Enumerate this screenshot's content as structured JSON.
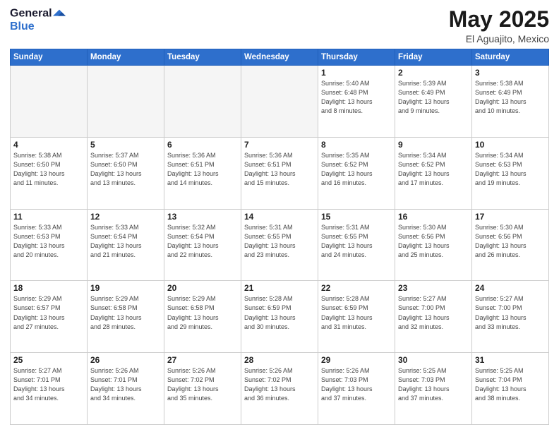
{
  "header": {
    "logo_general": "General",
    "logo_blue": "Blue",
    "month_title": "May 2025",
    "location": "El Aguajito, Mexico"
  },
  "days_of_week": [
    "Sunday",
    "Monday",
    "Tuesday",
    "Wednesday",
    "Thursday",
    "Friday",
    "Saturday"
  ],
  "weeks": [
    [
      {
        "day": "",
        "info": ""
      },
      {
        "day": "",
        "info": ""
      },
      {
        "day": "",
        "info": ""
      },
      {
        "day": "",
        "info": ""
      },
      {
        "day": "1",
        "info": "Sunrise: 5:40 AM\nSunset: 6:48 PM\nDaylight: 13 hours\nand 8 minutes."
      },
      {
        "day": "2",
        "info": "Sunrise: 5:39 AM\nSunset: 6:49 PM\nDaylight: 13 hours\nand 9 minutes."
      },
      {
        "day": "3",
        "info": "Sunrise: 5:38 AM\nSunset: 6:49 PM\nDaylight: 13 hours\nand 10 minutes."
      }
    ],
    [
      {
        "day": "4",
        "info": "Sunrise: 5:38 AM\nSunset: 6:50 PM\nDaylight: 13 hours\nand 11 minutes."
      },
      {
        "day": "5",
        "info": "Sunrise: 5:37 AM\nSunset: 6:50 PM\nDaylight: 13 hours\nand 13 minutes."
      },
      {
        "day": "6",
        "info": "Sunrise: 5:36 AM\nSunset: 6:51 PM\nDaylight: 13 hours\nand 14 minutes."
      },
      {
        "day": "7",
        "info": "Sunrise: 5:36 AM\nSunset: 6:51 PM\nDaylight: 13 hours\nand 15 minutes."
      },
      {
        "day": "8",
        "info": "Sunrise: 5:35 AM\nSunset: 6:52 PM\nDaylight: 13 hours\nand 16 minutes."
      },
      {
        "day": "9",
        "info": "Sunrise: 5:34 AM\nSunset: 6:52 PM\nDaylight: 13 hours\nand 17 minutes."
      },
      {
        "day": "10",
        "info": "Sunrise: 5:34 AM\nSunset: 6:53 PM\nDaylight: 13 hours\nand 19 minutes."
      }
    ],
    [
      {
        "day": "11",
        "info": "Sunrise: 5:33 AM\nSunset: 6:53 PM\nDaylight: 13 hours\nand 20 minutes."
      },
      {
        "day": "12",
        "info": "Sunrise: 5:33 AM\nSunset: 6:54 PM\nDaylight: 13 hours\nand 21 minutes."
      },
      {
        "day": "13",
        "info": "Sunrise: 5:32 AM\nSunset: 6:54 PM\nDaylight: 13 hours\nand 22 minutes."
      },
      {
        "day": "14",
        "info": "Sunrise: 5:31 AM\nSunset: 6:55 PM\nDaylight: 13 hours\nand 23 minutes."
      },
      {
        "day": "15",
        "info": "Sunrise: 5:31 AM\nSunset: 6:55 PM\nDaylight: 13 hours\nand 24 minutes."
      },
      {
        "day": "16",
        "info": "Sunrise: 5:30 AM\nSunset: 6:56 PM\nDaylight: 13 hours\nand 25 minutes."
      },
      {
        "day": "17",
        "info": "Sunrise: 5:30 AM\nSunset: 6:56 PM\nDaylight: 13 hours\nand 26 minutes."
      }
    ],
    [
      {
        "day": "18",
        "info": "Sunrise: 5:29 AM\nSunset: 6:57 PM\nDaylight: 13 hours\nand 27 minutes."
      },
      {
        "day": "19",
        "info": "Sunrise: 5:29 AM\nSunset: 6:58 PM\nDaylight: 13 hours\nand 28 minutes."
      },
      {
        "day": "20",
        "info": "Sunrise: 5:29 AM\nSunset: 6:58 PM\nDaylight: 13 hours\nand 29 minutes."
      },
      {
        "day": "21",
        "info": "Sunrise: 5:28 AM\nSunset: 6:59 PM\nDaylight: 13 hours\nand 30 minutes."
      },
      {
        "day": "22",
        "info": "Sunrise: 5:28 AM\nSunset: 6:59 PM\nDaylight: 13 hours\nand 31 minutes."
      },
      {
        "day": "23",
        "info": "Sunrise: 5:27 AM\nSunset: 7:00 PM\nDaylight: 13 hours\nand 32 minutes."
      },
      {
        "day": "24",
        "info": "Sunrise: 5:27 AM\nSunset: 7:00 PM\nDaylight: 13 hours\nand 33 minutes."
      }
    ],
    [
      {
        "day": "25",
        "info": "Sunrise: 5:27 AM\nSunset: 7:01 PM\nDaylight: 13 hours\nand 34 minutes."
      },
      {
        "day": "26",
        "info": "Sunrise: 5:26 AM\nSunset: 7:01 PM\nDaylight: 13 hours\nand 34 minutes."
      },
      {
        "day": "27",
        "info": "Sunrise: 5:26 AM\nSunset: 7:02 PM\nDaylight: 13 hours\nand 35 minutes."
      },
      {
        "day": "28",
        "info": "Sunrise: 5:26 AM\nSunset: 7:02 PM\nDaylight: 13 hours\nand 36 minutes."
      },
      {
        "day": "29",
        "info": "Sunrise: 5:26 AM\nSunset: 7:03 PM\nDaylight: 13 hours\nand 37 minutes."
      },
      {
        "day": "30",
        "info": "Sunrise: 5:25 AM\nSunset: 7:03 PM\nDaylight: 13 hours\nand 37 minutes."
      },
      {
        "day": "31",
        "info": "Sunrise: 5:25 AM\nSunset: 7:04 PM\nDaylight: 13 hours\nand 38 minutes."
      }
    ]
  ]
}
